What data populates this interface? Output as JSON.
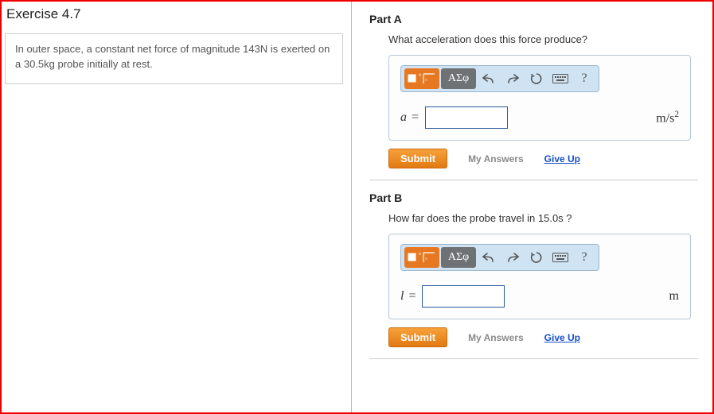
{
  "exercise": {
    "title": "Exercise 4.7",
    "problem_html": "In outer space, a constant net force of magnitude 143N is exerted on a 30.5kg probe initially at rest."
  },
  "parts": [
    {
      "id": "A",
      "title": "Part A",
      "question": "What acceleration does this force produce?",
      "variable": "a",
      "unit_html": "m/s²",
      "value": ""
    },
    {
      "id": "B",
      "title": "Part B",
      "question": "How far does the probe travel in 15.0s ?",
      "variable": "l",
      "unit_html": "m",
      "value": ""
    }
  ],
  "toolbar": {
    "template_label": "template",
    "greek_label": "ΑΣφ",
    "undo_label": "undo",
    "redo_label": "redo",
    "reset_label": "reset",
    "keyboard_label": "keyboard",
    "help_label": "?"
  },
  "actions": {
    "submit": "Submit",
    "my_answers": "My Answers",
    "give_up": "Give Up"
  }
}
